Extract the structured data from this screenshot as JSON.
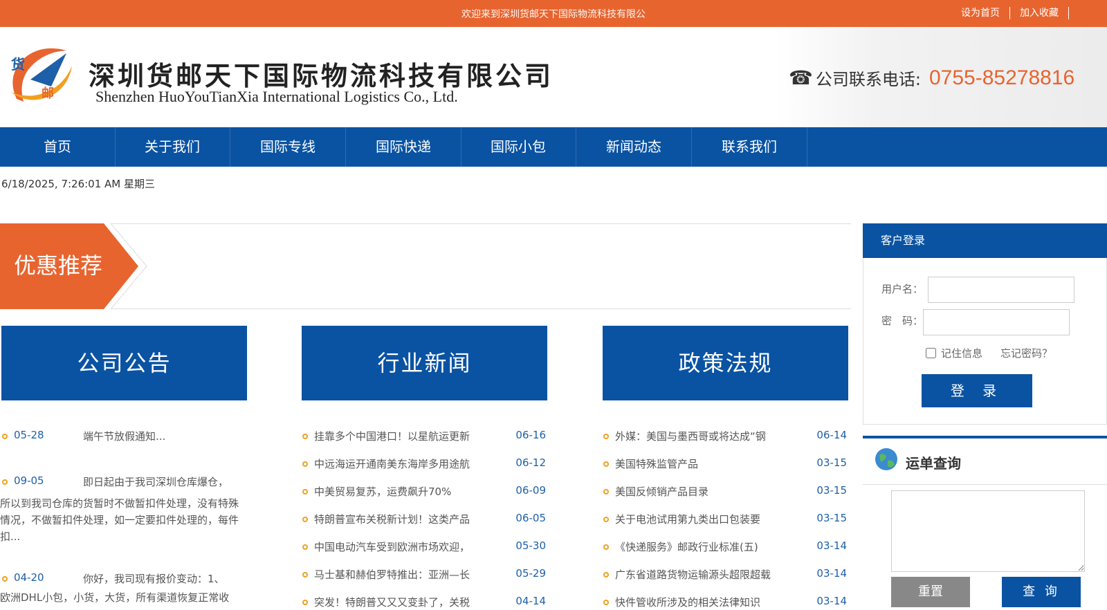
{
  "topbar": {
    "welcome": "欢迎来到深圳货邮天下国际物流科技有限公",
    "set_home": "设为首页",
    "add_fav": "加入收藏"
  },
  "header": {
    "logo_text": "货邮",
    "cn_name": "深圳货邮天下国际物流科技有限公司",
    "en_name": "Shenzhen HuoYouTianXia International Logistics Co., Ltd.",
    "phone_label": "公司联系电话:",
    "phone_number": "0755-85278816"
  },
  "nav": [
    "首页",
    "关于我们",
    "国际专线",
    "国际快递",
    "国际小包",
    "新闻动态",
    "联系我们"
  ],
  "datetime": "6/18/2025, 7:26:01 AM 星期三",
  "promo": {
    "label": "优惠推荐"
  },
  "columns": {
    "announcements": {
      "title": "公司公告",
      "items": [
        {
          "date": "05-28",
          "title": "端午节放假通知...",
          "more": ""
        },
        {
          "date": "09-05",
          "title": "即日起由于我司深圳仓库爆仓，",
          "more": "所以到我司仓库的货暂时不做暂扣件处理，没有特殊情况，不做暂扣件处理，如一定要扣件处理的，每件扣..."
        },
        {
          "date": "04-20",
          "title": "你好，我司现有报价变动：1、",
          "more": "欧洲DHL小包，小货，大货，所有渠道恢复正常收"
        }
      ]
    },
    "industry": {
      "title": "行业新闻",
      "items": [
        {
          "title": "挂靠多个中国港口！以星航运更新",
          "date": "06-16"
        },
        {
          "title": "中远海运开通南美东海岸多用途航",
          "date": "06-12"
        },
        {
          "title": "中美贸易复苏，运费飙升70%",
          "date": "06-09"
        },
        {
          "title": "特朗普宣布关税新计划！这类产品",
          "date": "06-05"
        },
        {
          "title": "中国电动汽车受到欧洲市场欢迎，",
          "date": "05-30"
        },
        {
          "title": "马士基和赫伯罗特推出：亚洲—长",
          "date": "05-29"
        },
        {
          "title": "突发！特朗普又又又变卦了，关税",
          "date": "04-14"
        }
      ]
    },
    "policy": {
      "title": "政策法规",
      "items": [
        {
          "title": "外媒：美国与墨西哥或将达成“钢",
          "date": "06-14"
        },
        {
          "title": "美国特殊监管产品",
          "date": "03-15"
        },
        {
          "title": "美国反倾销产品目录",
          "date": "03-15"
        },
        {
          "title": "关于电池试用第九类出口包装要",
          "date": "03-15"
        },
        {
          "title": "《快递服务》邮政行业标准(五)",
          "date": "03-14"
        },
        {
          "title": "广东省道路货物运输源头超限超载",
          "date": "03-14"
        },
        {
          "title": "快件管收所涉及的相关法律知识",
          "date": "03-14"
        }
      ]
    }
  },
  "login": {
    "title": "客户登录",
    "username_label": "用户名：",
    "password_label": "密　码：",
    "remember": "记住信息",
    "forgot": "忘记密码？",
    "submit": "登 录"
  },
  "tracking": {
    "title": "运单查询",
    "reset": "重置",
    "query": "查 询"
  },
  "colors": {
    "accent": "#e8642f",
    "primary": "#0a53a3"
  }
}
